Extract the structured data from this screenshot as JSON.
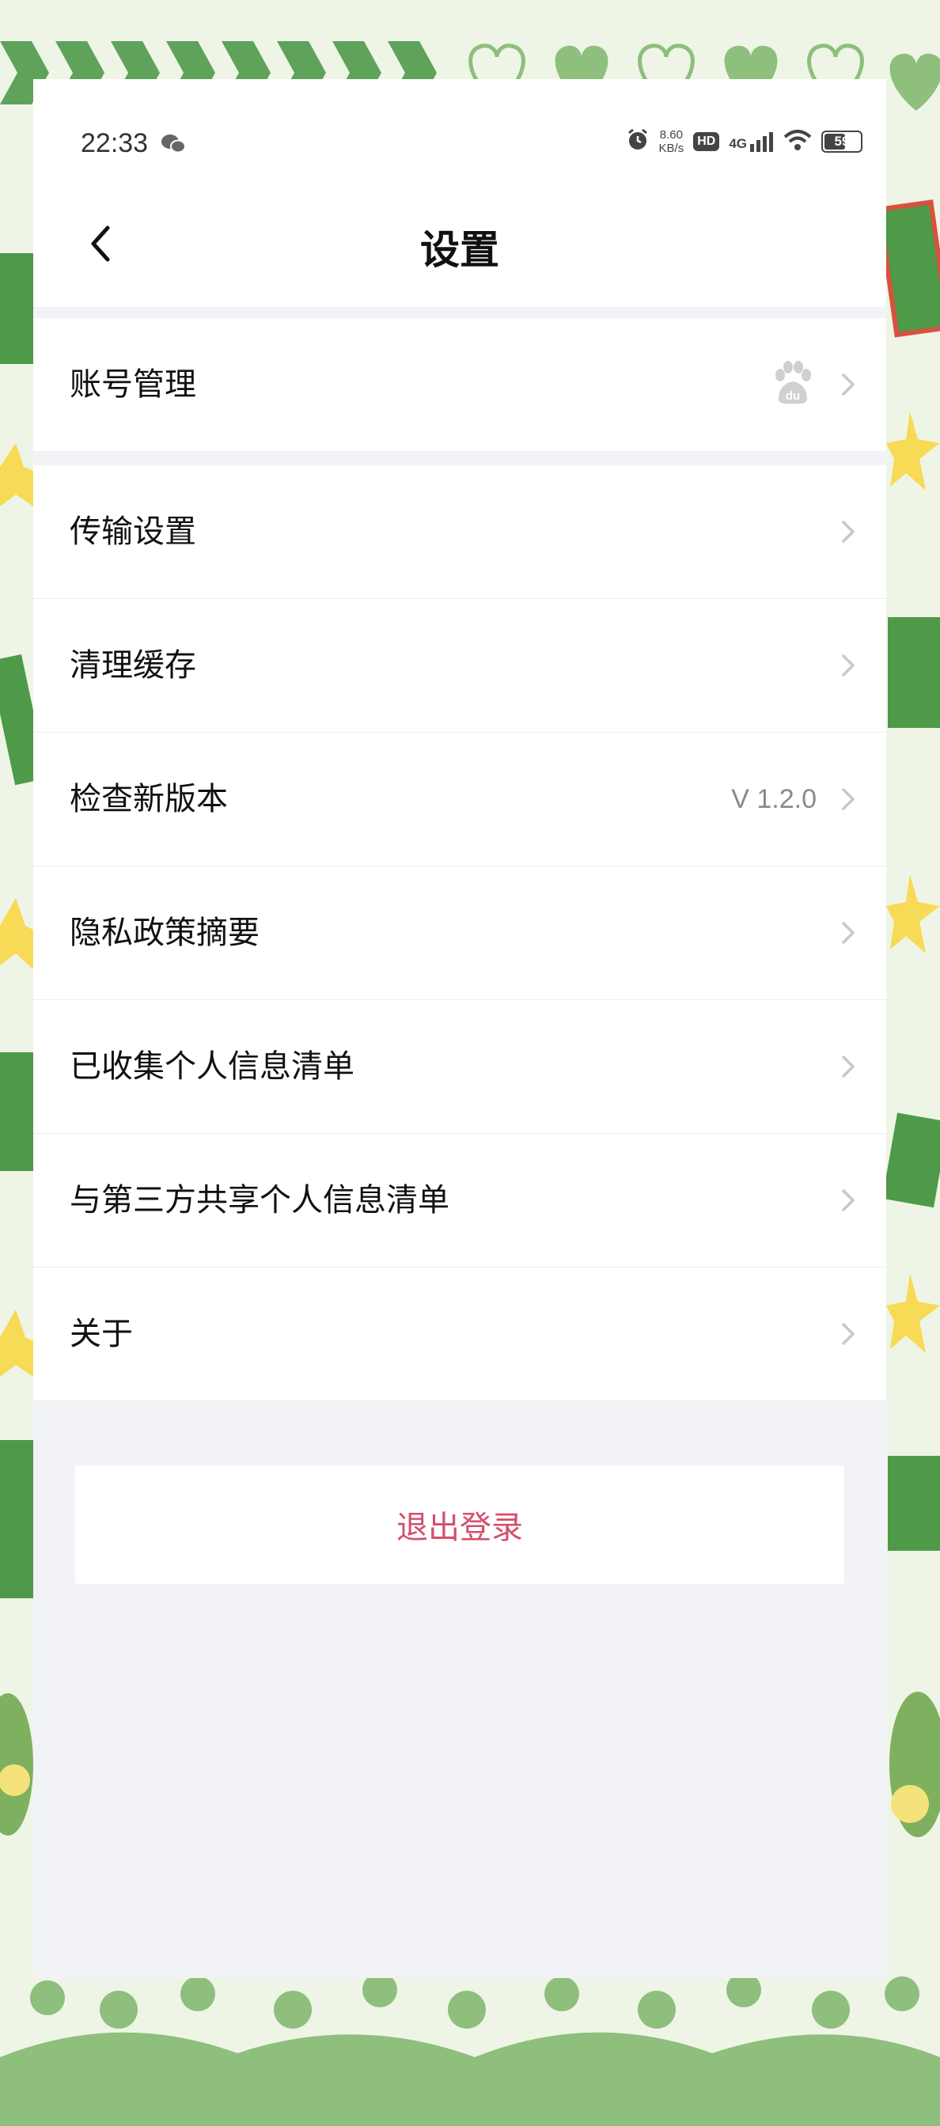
{
  "status_bar": {
    "time": "22:33",
    "speed_value": "8.60",
    "speed_unit": "KB/s",
    "hd": "HD",
    "network": "4G",
    "battery": "59"
  },
  "header": {
    "title": "设置"
  },
  "account": {
    "label": "账号管理",
    "icon": "baidu-paw-icon"
  },
  "settings": {
    "items": [
      {
        "label": "传输设置",
        "value": ""
      },
      {
        "label": "清理缓存",
        "value": ""
      },
      {
        "label": "检查新版本",
        "value": "V 1.2.0"
      },
      {
        "label": "隐私政策摘要",
        "value": ""
      },
      {
        "label": "已收集个人信息清单",
        "value": ""
      },
      {
        "label": "与第三方共享个人信息清单",
        "value": ""
      },
      {
        "label": "关于",
        "value": ""
      }
    ]
  },
  "logout": {
    "label": "退出登录"
  },
  "colors": {
    "accent_logout": "#d44f6d",
    "frame_green": "#5fa35a",
    "background": "#f2f3f7"
  }
}
